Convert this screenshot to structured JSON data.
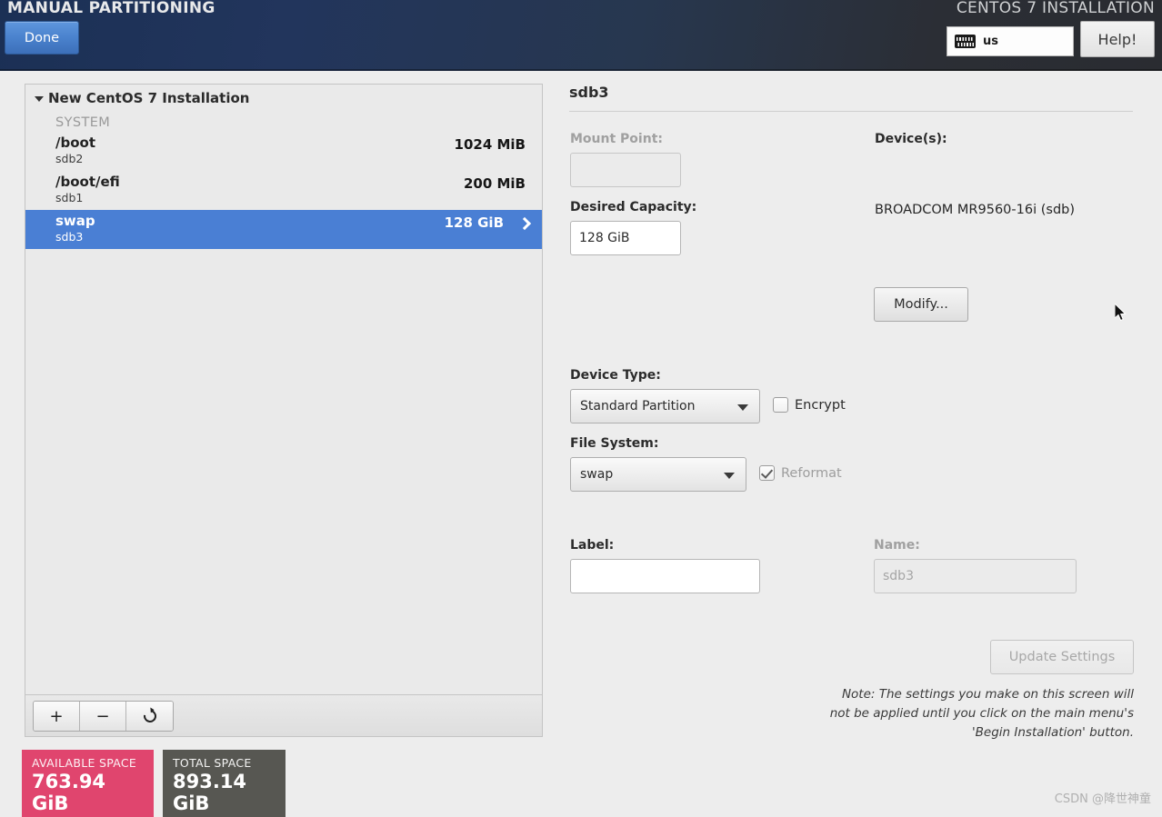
{
  "header": {
    "title_left": "MANUAL PARTITIONING",
    "title_right": "CENTOS 7 INSTALLATION",
    "done_label": "Done",
    "help_label": "Help!",
    "keyboard_layout": "us",
    "keyboard_icon": "keyboard-icon",
    "accent_blue": "#4a82cd",
    "bg_left": "#1b3055",
    "bg_right": "#2a2c31"
  },
  "left_panel": {
    "tree_root_label": "New CentOS 7 Installation",
    "group_label": "SYSTEM",
    "partitions": [
      {
        "mount": "/boot",
        "device": "sdb2",
        "size": "1024 MiB",
        "selected": false
      },
      {
        "mount": "/boot/efi",
        "device": "sdb1",
        "size": "200 MiB",
        "selected": false
      },
      {
        "mount": "swap",
        "device": "sdb3",
        "size": "128 GiB",
        "selected": true
      }
    ],
    "toolbar": {
      "add_label": "+",
      "remove_label": "−",
      "refresh_icon": "refresh-icon"
    },
    "badges": {
      "available_caption": "AVAILABLE SPACE",
      "available_value": "763.94 GiB",
      "available_color": "#e0456e",
      "total_caption": "TOTAL SPACE",
      "total_value": "893.14 GiB",
      "total_color": "#575752"
    }
  },
  "right_panel": {
    "title": "sdb3",
    "mount_point_label": "Mount Point:",
    "mount_point_value": "",
    "desired_capacity_label": "Desired Capacity:",
    "desired_capacity_value": "128 GiB",
    "devices_label": "Device(s):",
    "devices_value": "BROADCOM MR9560-16i (sdb)",
    "modify_label": "Modify...",
    "device_type_label": "Device Type:",
    "device_type_value": "Standard Partition",
    "encrypt_label": "Encrypt",
    "file_system_label": "File System:",
    "file_system_value": "swap",
    "reformat_label": "Reformat",
    "label_label": "Label:",
    "label_value": "",
    "name_label": "Name:",
    "name_value": "sdb3",
    "update_settings_label": "Update Settings",
    "note_text": "Note:  The settings you make on this screen will not be applied until you click on the main menu's 'Begin Installation' button."
  },
  "watermark": "CSDN @降世神童"
}
